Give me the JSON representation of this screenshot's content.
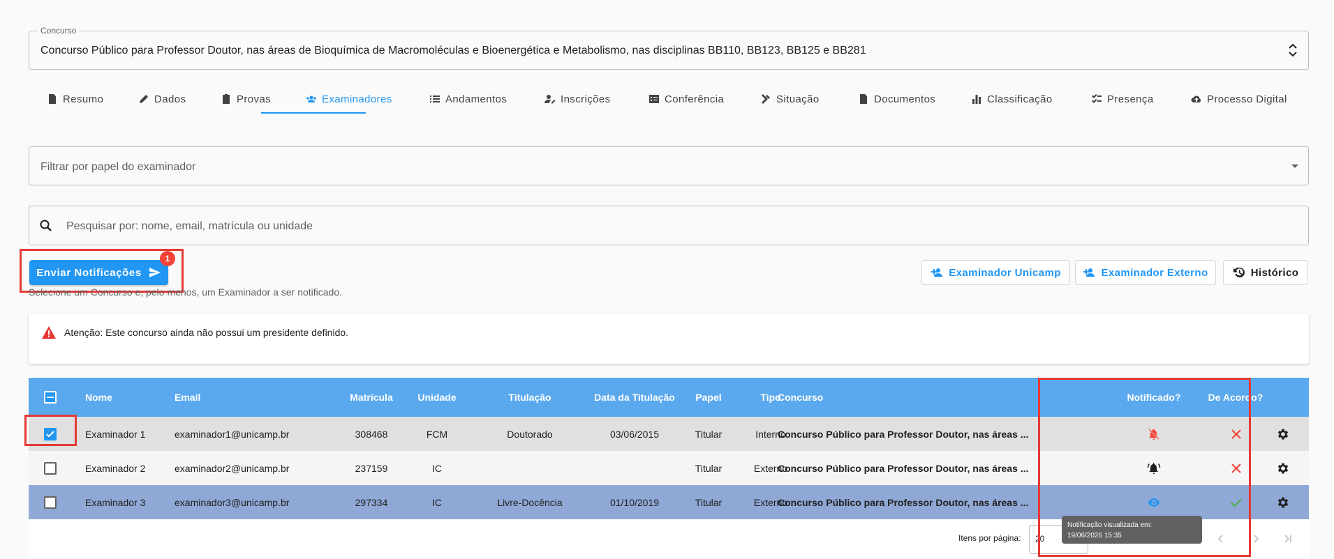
{
  "concurso": {
    "legend": "Concurso",
    "value": "Concurso Público para Professor Doutor, nas áreas de Bioquímica de Macromoléculas e Bioenergética e Metabolismo, nas disciplinas BB110, BB123, BB125 e BB281"
  },
  "tabs": [
    {
      "label": "Resumo",
      "icon": "document-icon"
    },
    {
      "label": "Dados",
      "icon": "pencil-icon"
    },
    {
      "label": "Provas",
      "icon": "clipboard-icon"
    },
    {
      "label": "Examinadores",
      "icon": "group-icon",
      "active": true
    },
    {
      "label": "Andamentos",
      "icon": "list-icon"
    },
    {
      "label": "Inscrições",
      "icon": "person-edit-icon"
    },
    {
      "label": "Conferência",
      "icon": "checklist-box-icon"
    },
    {
      "label": "Situação",
      "icon": "gavel-icon"
    },
    {
      "label": "Documentos",
      "icon": "file-icon"
    },
    {
      "label": "Classificação",
      "icon": "bar-chart-icon"
    },
    {
      "label": "Presença",
      "icon": "checklist-icon"
    },
    {
      "label": "Processo Digital",
      "icon": "cloud-upload-icon"
    }
  ],
  "filter": {
    "placeholder": "Filtrar por papel do examinador"
  },
  "search": {
    "placeholder": "Pesquisar por: nome, email, matrícula ou unidade"
  },
  "actions": {
    "send_notifications": "Enviar Notificações",
    "badge_count": "1",
    "helper": "Selecione um Concurso e, pelo menos, um Examinador a ser notificado.",
    "add_unicamp": "Examinador Unicamp",
    "add_external": "Examinador Externo",
    "history": "Histórico"
  },
  "alert": {
    "text": "Atenção: Este concurso ainda não possui um presidente definido."
  },
  "table": {
    "headers": {
      "nome": "Nome",
      "email": "Email",
      "matricula": "Matrícula",
      "unidade": "Unidade",
      "titulacao": "Titulação",
      "data_titulacao": "Data da Titulação",
      "papel": "Papel",
      "tipo": "Tipo",
      "concurso": "Concurso",
      "notificado": "Notificado?",
      "de_acordo": "De Acordo?"
    },
    "rows": [
      {
        "checked": true,
        "nome": "Examinador 1",
        "email": "examinador1@unicamp.br",
        "matricula": "308468",
        "unidade": "FCM",
        "titulacao": "Doutorado",
        "data_titulacao": "03/06/2015",
        "papel": "Titular",
        "tipo": "Interno",
        "concurso": "Concurso Público para Professor Doutor, nas áreas ...",
        "notificado": "bell-off-icon",
        "de_acordo": "x-icon"
      },
      {
        "checked": false,
        "nome": "Examinador 2",
        "email": "examinador2@unicamp.br",
        "matricula": "237159",
        "unidade": "IC",
        "titulacao": "",
        "data_titulacao": "",
        "papel": "Titular",
        "tipo": "Externo",
        "concurso": "Concurso Público para Professor Doutor, nas áreas ...",
        "notificado": "bell-ringing-icon",
        "de_acordo": "x-icon"
      },
      {
        "checked": false,
        "nome": "Examinador 3",
        "email": "examinador3@unicamp.br",
        "matricula": "297334",
        "unidade": "IC",
        "titulacao": "Livre-Docência",
        "data_titulacao": "01/10/2019",
        "papel": "Titular",
        "tipo": "Externo",
        "concurso": "Concurso Público para Professor Doutor, nas áreas ...",
        "notificado": "eye-icon",
        "de_acordo": "check-icon"
      }
    ]
  },
  "tooltip": {
    "line1": "Notificação visualizada em:",
    "line2": "19/06/2026 15:35"
  },
  "pagination": {
    "label": "Itens por página:",
    "page_size": "20"
  },
  "colors": {
    "primary": "#2196f3",
    "header_bg": "#5aa9ef",
    "error": "#f44336",
    "success": "#4caf50",
    "highlight": "#e53935"
  }
}
